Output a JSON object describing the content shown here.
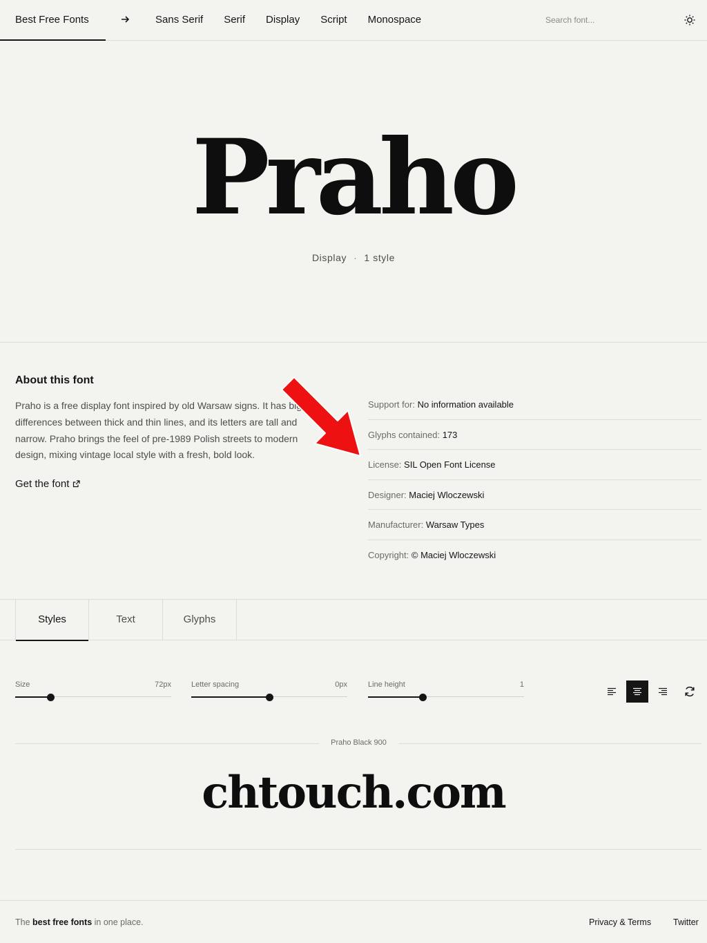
{
  "header": {
    "brand": "Best Free Fonts",
    "nav": [
      "Sans Serif",
      "Serif",
      "Display",
      "Script",
      "Monospace"
    ],
    "search_placeholder": "Search font..."
  },
  "hero": {
    "title": "Praho",
    "category": "Display",
    "separator": "·",
    "styles": "1 style"
  },
  "about": {
    "title": "About this font",
    "description": "Praho is a free display font inspired by old Warsaw signs. It has big differences between thick and thin lines, and its letters are tall and narrow. Praho brings the feel of pre-1989 Polish streets to modern design, mixing vintage local style with a fresh, bold look.",
    "cta": "Get the font"
  },
  "details": [
    {
      "label": "Support for:",
      "value": "No information available"
    },
    {
      "label": "Glyphs contained:",
      "value": "173"
    },
    {
      "label": "License:",
      "value": "SIL Open Font License"
    },
    {
      "label": "Designer:",
      "value": "Maciej Wloczewski"
    },
    {
      "label": "Manufacturer:",
      "value": "Warsaw Types"
    },
    {
      "label": "Copyright:",
      "value": "© Maciej Wloczewski"
    }
  ],
  "tabs": [
    "Styles",
    "Text",
    "Glyphs"
  ],
  "active_tab": "Styles",
  "controls": {
    "size": {
      "label": "Size",
      "value_text": "72px",
      "level": 0.23
    },
    "letter_spacing": {
      "label": "Letter spacing",
      "value_text": "0px",
      "level": 0.5
    },
    "line_height": {
      "label": "Line height",
      "value_text": "1",
      "level": 0.35
    }
  },
  "text_align": "center",
  "preview": {
    "style_name": "Praho Black 900",
    "sample_text": "chtouch.com"
  },
  "footer": {
    "tagline_prefix": "The",
    "tagline_bold": "best free fonts",
    "tagline_suffix": "in one place.",
    "links": [
      "Privacy & Terms",
      "Twitter"
    ]
  },
  "colors": {
    "background": "#f3f3f0",
    "text": "#151515",
    "annotation_arrow": "#ee1111"
  },
  "icons": [
    "arrow-right-icon",
    "sun-icon",
    "external-link-icon",
    "align-left-icon",
    "align-center-icon",
    "align-right-icon",
    "reset-icon",
    "red-arrow-annotation"
  ]
}
